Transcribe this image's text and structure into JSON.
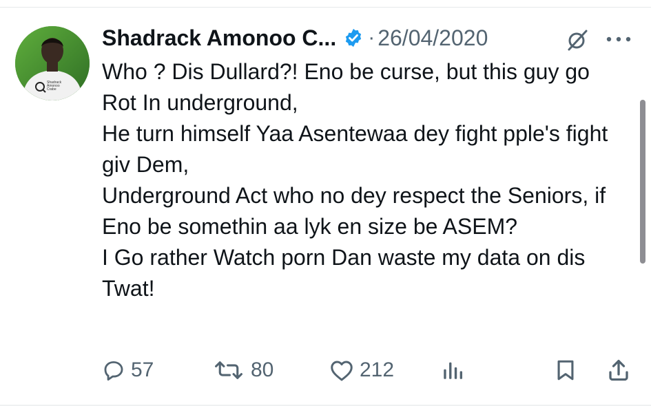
{
  "tweet": {
    "display_name": "Shadrack Amonoo C...",
    "separator": "·",
    "date": "26/04/2020",
    "avatar_shirt_text": [
      "Shadrack",
      "Amonoo",
      "Crabe"
    ],
    "text": "Who ? Dis Dullard?! Eno be curse, but this guy go Rot In underground,\nHe turn himself Yaa Asentewaa dey fight pple's fight giv Dem,\nUnderground Act who no dey respect the Seniors, if Eno be somethin aa lyk en size be ASEM?\nI Go rather Watch porn Dan waste my data on dis Twat!"
  },
  "actions": {
    "replies": "57",
    "reposts": "80",
    "likes": "212"
  },
  "icons": {
    "verified": "verified-badge-icon",
    "grok": "grok-icon",
    "more": "more-icon",
    "reply": "reply-icon",
    "repost": "repost-icon",
    "like": "heart-icon",
    "views": "views-icon",
    "bookmark": "bookmark-icon",
    "share": "share-icon"
  },
  "colors": {
    "verified": "#1d9bf0",
    "text": "#0f1419",
    "secondary": "#536471"
  }
}
